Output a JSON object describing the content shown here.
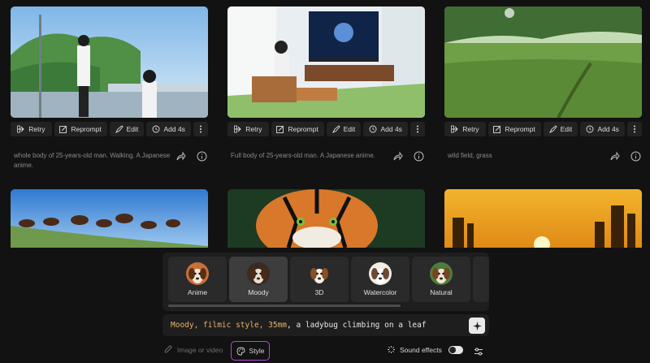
{
  "actions": {
    "retry": "Retry",
    "reprompt": "Reprompt",
    "edit": "Edit",
    "add4s": "Add 4s"
  },
  "cards": [
    {
      "caption": "whole body of 25-years-old man. Walking. A Japanese anime."
    },
    {
      "caption": "Full body of 25-years-old man. A Japanese anime."
    },
    {
      "caption": "wild field, grass"
    }
  ],
  "styles": {
    "items": [
      "Anime",
      "Moody",
      "3D",
      "Watercolor",
      "Natural"
    ],
    "selected": "Moody"
  },
  "prompt": {
    "style_prefix": "Moody, filmic style, 35mm",
    "text": ", a ladybug climbing on a leaf"
  },
  "bottom": {
    "image_or_video": "Image or video",
    "style": "Style",
    "sound_effects": "Sound effects"
  },
  "icons": [
    "retry-icon",
    "reprompt-icon",
    "edit-icon",
    "add-time-icon",
    "more-icon",
    "share-icon",
    "info-icon",
    "sparkle-icon",
    "paperclip-icon",
    "palette-icon",
    "sound-icon",
    "sliders-icon"
  ],
  "colors": {
    "style_accent": "#b146d6",
    "prompt_highlight": "#e5b567"
  }
}
